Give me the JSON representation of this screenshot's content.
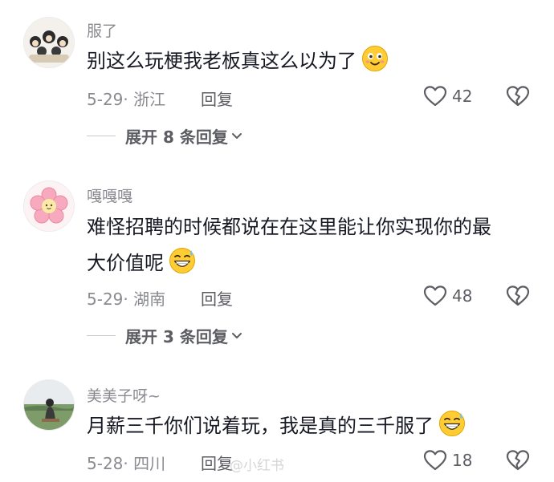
{
  "comments": [
    {
      "username": "服了",
      "text": "别这么玩梗我老板真这么以为了",
      "emoji": "smiling-face-emoji",
      "date_location": "5-29· 浙江",
      "reply_label": "回复",
      "likes": "42",
      "expand_label": "展开 8 条回复"
    },
    {
      "username": "嘎嘎嘎",
      "text_line1": "难怪招聘的时候都说在在这里能让你实现你的最",
      "text_line2": "大价值呢",
      "emoji": "sweat-grin-emoji",
      "date_location": "5-29· 湖南",
      "reply_label": "回复",
      "likes": "48",
      "expand_label": "展开 3 条回复"
    },
    {
      "username": "美美子呀~",
      "text": "月薪三千你们说着玩，我是真的三千服了",
      "emoji": "sweat-grin-emoji",
      "date_location": "5-28· 四川",
      "reply_label": "回复",
      "likes": "18"
    }
  ],
  "icons": {
    "like": "heart-outline-icon",
    "dislike": "broken-heart-icon",
    "expand": "chevron-down-icon"
  },
  "colors": {
    "text": "#161823",
    "meta": "#8a8b91",
    "action": "#5c5d63"
  },
  "watermark": "@小红书"
}
